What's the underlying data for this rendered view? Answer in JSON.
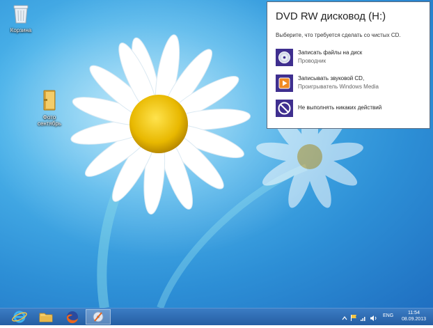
{
  "desktop": {
    "icons": [
      {
        "label": "Корзина",
        "icon": "recycle-bin-icon"
      },
      {
        "label_line1": "Фото",
        "label_line2": "сентябрь",
        "icon": "folder-icon"
      }
    ]
  },
  "autoplay": {
    "title": "DVD RW дисковод (H:)",
    "subtitle": "Выберите, что требуется сделать со чистых CD.",
    "options": [
      {
        "label": "Записать файлы на диск",
        "sub": "Проводник",
        "icon": "burn-disc-icon"
      },
      {
        "label": "Записывать звуковой CD,",
        "sub": "Проигрыватель Windows Media",
        "icon": "media-player-icon"
      },
      {
        "label": "Не выполнять никаких действий",
        "sub": "",
        "icon": "no-action-icon"
      }
    ],
    "accent": "#3f2f8f"
  },
  "taskbar": {
    "apps": [
      {
        "name": "internet-explorer",
        "icon": "internet-explorer-icon"
      },
      {
        "name": "file-explorer",
        "icon": "folder-icon"
      },
      {
        "name": "firefox",
        "icon": "firefox-icon"
      },
      {
        "name": "disc-burner",
        "icon": "disc-burn-app-icon"
      }
    ],
    "language": "ENG",
    "time": "11:54",
    "date": "08.09.2013"
  }
}
